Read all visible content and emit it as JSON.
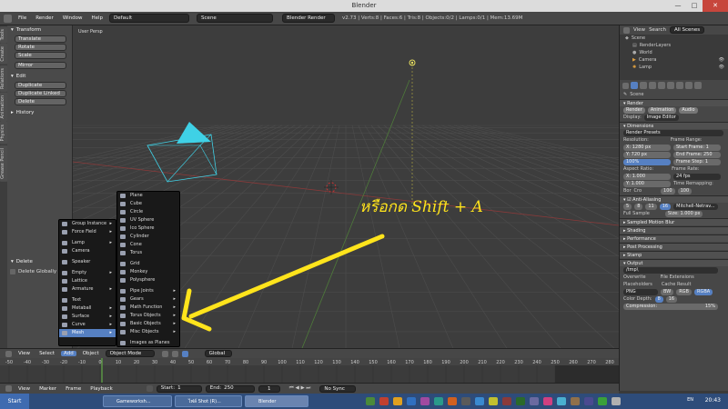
{
  "window": {
    "title": "Blender",
    "min": "—",
    "max": "□",
    "close": "✕"
  },
  "info": {
    "menus": [
      "File",
      "Render",
      "Window",
      "Help"
    ],
    "layout": "Default",
    "scene": "Scene",
    "engine": "Blender Render",
    "stats": "v2.73 | Verts:8 | Faces:6 | Tris:8 | Objects:0/2 | Lamps:0/1 | Mem:13.69M"
  },
  "toolshelf": {
    "tabs": [
      "Tools",
      "Create",
      "Relations",
      "Animation",
      "Physics",
      "Grease Pencil"
    ],
    "transform_title": "Transform",
    "transform_buttons": [
      "Translate",
      "Rotate",
      "Scale",
      "Mirror"
    ],
    "edit_title": "Edit",
    "edit_buttons": [
      "Duplicate",
      "Duplicate Linked",
      "Delete"
    ],
    "history_title": "History",
    "delete_title": "Delete",
    "delete_globally": "Delete Globally"
  },
  "viewport": {
    "label": "User Persp",
    "overlay_text": "หรือกด Shift + A"
  },
  "add_menu": {
    "items": [
      {
        "label": "Group Instance",
        "arrow": "▸"
      },
      {
        "label": "Force Field",
        "arrow": "▸"
      },
      {
        "label": "Lamp",
        "arrow": "▸"
      },
      {
        "label": "Camera",
        "arrow": ""
      },
      {
        "label": "Speaker",
        "arrow": ""
      },
      {
        "label": "Empty",
        "arrow": "▸"
      },
      {
        "label": "Lattice",
        "arrow": ""
      },
      {
        "label": "Armature",
        "arrow": "▸"
      },
      {
        "label": "Text",
        "arrow": ""
      },
      {
        "label": "Metaball",
        "arrow": "▸"
      },
      {
        "label": "Surface",
        "arrow": "▸"
      },
      {
        "label": "Curve",
        "arrow": "▸"
      },
      {
        "label": "Mesh",
        "arrow": "▸"
      }
    ]
  },
  "mesh_menu": {
    "items": [
      {
        "label": "Plane",
        "arrow": ""
      },
      {
        "label": "Cube",
        "arrow": ""
      },
      {
        "label": "Circle",
        "arrow": ""
      },
      {
        "label": "UV Sphere",
        "arrow": ""
      },
      {
        "label": "Ico Sphere",
        "arrow": ""
      },
      {
        "label": "Cylinder",
        "arrow": ""
      },
      {
        "label": "Cone",
        "arrow": ""
      },
      {
        "label": "Torus",
        "arrow": ""
      },
      {
        "label": "Grid",
        "arrow": ""
      },
      {
        "label": "Monkey",
        "arrow": ""
      },
      {
        "label": "Polysphere",
        "arrow": ""
      },
      {
        "label": "Pipe Joints",
        "arrow": "▸"
      },
      {
        "label": "Gears",
        "arrow": "▸"
      },
      {
        "label": "Math Function",
        "arrow": "▸"
      },
      {
        "label": "Torus Objects",
        "arrow": "▸"
      },
      {
        "label": "Basic Objects",
        "arrow": "▸"
      },
      {
        "label": "Misc Objects",
        "arrow": "▸"
      },
      {
        "label": "Images as Planes",
        "arrow": ""
      }
    ]
  },
  "vp_header": {
    "items": [
      "View",
      "Select",
      "Add",
      "Object"
    ],
    "mode": "Object Mode",
    "pivot": "Global"
  },
  "timeline": {
    "ticks": [
      "-50",
      "-40",
      "-30",
      "-20",
      "-10",
      "0",
      "10",
      "20",
      "30",
      "40",
      "50",
      "60",
      "70",
      "80",
      "90",
      "100",
      "110",
      "120",
      "130",
      "140",
      "150",
      "160",
      "170",
      "180",
      "190",
      "200",
      "210",
      "220",
      "230",
      "240",
      "250",
      "260",
      "270",
      "280"
    ],
    "menus": [
      "View",
      "Marker",
      "Frame",
      "Playback"
    ],
    "start": "Start:",
    "start_val": "1",
    "end": "End:",
    "end_val": "250",
    "current": "1",
    "sync": "No Sync"
  },
  "outliner": {
    "tabs": [
      "View",
      "Search",
      "All Scenes"
    ],
    "items": [
      "Scene",
      "RenderLayers",
      "World",
      "Camera",
      "Lamp"
    ]
  },
  "props": {
    "scene": "Scene",
    "render": "Render",
    "render_btns": [
      "Render",
      "Animation",
      "Audio"
    ],
    "display": "Display:",
    "display_val": "Image Editor",
    "dimensions": "Dimensions",
    "presets": "Render Presets",
    "resolution": "Resolution:",
    "res_x": "X:",
    "res_x_val": "1280 px",
    "res_y": "Y:",
    "res_y_val": "720 px",
    "res_pct": "100%",
    "frame_range": "Frame Range:",
    "start_frame": "Start Frame:",
    "start_frame_val": "1",
    "end_frame": "End Frame:",
    "end_frame_val": "250",
    "frame_step": "Frame Step:",
    "frame_step_val": "1",
    "aspect": "Aspect Ratio:",
    "asp_x": "X:",
    "asp_x_val": "1.000",
    "asp_y": "Y:",
    "asp_y_val": "1.000",
    "frame_rate": "Frame Rate:",
    "fps": "24 fps",
    "time_remap": "Time Remapping:",
    "remap_a": "100",
    "remap_b": "100",
    "border": "Bor",
    "crop": "Cro",
    "aa": "Anti-Aliasing",
    "aa_samples": [
      "5",
      "8",
      "11",
      "16"
    ],
    "aa_filter": "Mitchell-Netrav...",
    "full_sample": "Full Sample",
    "size": "Size:",
    "size_val": "1.000 px",
    "sampled_blur": "Sampled Motion Blur",
    "shading": "Shading",
    "performance": "Performance",
    "post": "Post Processing",
    "stamp": "Stamp",
    "output": "Output",
    "output_path": "/tmp\\",
    "overwrite": "Overwrite",
    "file_ext": "File Extensions",
    "placeholders": "Placeholders",
    "cache": "Cache Result",
    "format": "PNG",
    "color_modes": [
      "BW",
      "RGB",
      "RGBA"
    ],
    "color_depth": "Color Depth:",
    "depth_a": "8",
    "depth_b": "16",
    "compression": "Compression:",
    "compression_val": "15%"
  },
  "taskbar": {
    "start": "Start",
    "tasks": [
      "Gameworksh...",
      "ไฟล์ Shot (R)...",
      "Blender"
    ],
    "lang": "EN",
    "time": "20:43"
  },
  "colors": {
    "camera": "#3fd1e6",
    "overlay": "#ffe41c",
    "highlight": "#5680c2"
  }
}
